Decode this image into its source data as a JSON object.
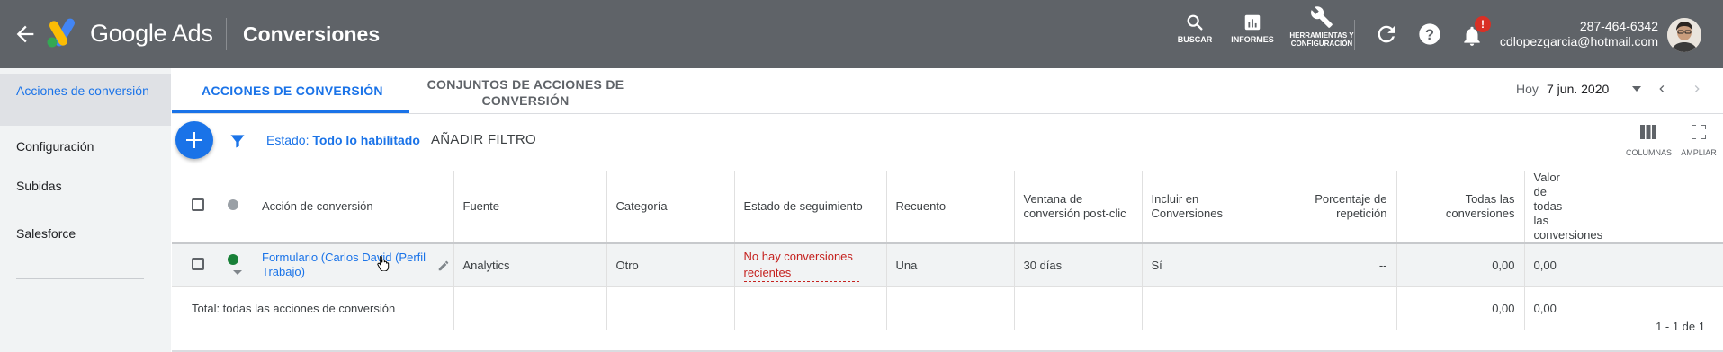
{
  "header": {
    "brand": "Google Ads",
    "page_title": "Conversiones",
    "tools": [
      {
        "icon": "search-icon",
        "label": "BUSCAR"
      },
      {
        "icon": "reports-icon",
        "label": "INFORMES"
      },
      {
        "icon": "wrench-icon",
        "label": "HERRAMIENTAS Y CONFIGURACIÓN"
      }
    ],
    "notification_badge": "!",
    "account_id": "287-464-6342",
    "account_email": "cdlopezgarcia@hotmail.com"
  },
  "sidebar": {
    "items": [
      {
        "label": "Acciones de conversión",
        "selected": true
      },
      {
        "label": "Configuración"
      },
      {
        "label": "Subidas"
      },
      {
        "label": "Salesforce"
      }
    ]
  },
  "tabs": [
    {
      "label": "ACCIONES DE CONVERSIÓN",
      "active": true
    },
    {
      "label": "CONJUNTOS DE ACCIONES DE CONVERSIÓN"
    }
  ],
  "date": {
    "label": "Hoy",
    "value": "7 jun. 2020"
  },
  "filter": {
    "estado_label": "Estado:",
    "estado_value": "Todo lo habilitado",
    "add_filter": "AÑADIR FILTRO"
  },
  "right_tools": [
    {
      "icon": "columns-icon",
      "label": "COLUMNAS"
    },
    {
      "icon": "expand-icon",
      "label": "AMPLIAR"
    }
  ],
  "table": {
    "headers": [
      "Acción de conversión",
      "Fuente",
      "Categoría",
      "Estado de seguimiento",
      "Recuento",
      "Ventana de conversión post-clic",
      "Incluir en Conversiones",
      "Porcentaje de repetición",
      "Todas las conversiones",
      "Valor de todas las conversiones"
    ],
    "rows": [
      {
        "name": "Formulario (Carlos David (Perfil Trabajo)",
        "source": "Analytics",
        "category": "Otro",
        "tracking_status": "No hay conversiones recientes",
        "count": "Una",
        "window": "30 días",
        "include": "Sí",
        "repeat_rate": "--",
        "all_conversions": "0,00",
        "all_conversions_value": "0,00",
        "status_color": "#188038"
      }
    ],
    "total": {
      "label": "Total: todas las acciones de conversión",
      "all_conversions": "0,00",
      "all_conversions_value": "0,00"
    }
  },
  "pagination": "1 - 1 de 1",
  "colors": {
    "topbar": "#5f6368",
    "accent": "#1a73e8",
    "warning": "#c5221f",
    "status_ok": "#188038"
  }
}
